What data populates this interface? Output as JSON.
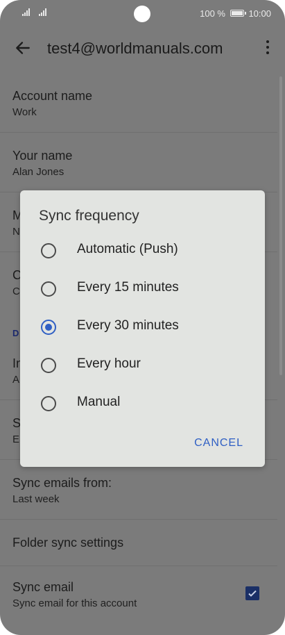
{
  "status": {
    "battery": "100 %",
    "time": "10:00"
  },
  "appbar": {
    "title": "test4@worldmanuals.com"
  },
  "settings": {
    "account_name": {
      "title": "Account name",
      "value": "Work"
    },
    "your_name": {
      "title": "Your name",
      "value": "Alan Jones"
    },
    "row3": {
      "title": "M",
      "value": "N"
    },
    "row4": {
      "title": "C",
      "value": "C"
    },
    "section": "D",
    "row6": {
      "title": "In",
      "value": "A"
    },
    "row7": {
      "title": "S",
      "value": "E"
    },
    "sync_emails_from": {
      "title": "Sync emails from:",
      "value": "Last week"
    },
    "folder_sync": {
      "title": "Folder sync settings"
    },
    "sync_email": {
      "title": "Sync email",
      "value": "Sync email for this account",
      "checked": true
    }
  },
  "dialog": {
    "title": "Sync frequency",
    "options": [
      {
        "label": "Automatic (Push)",
        "selected": false
      },
      {
        "label": "Every 15 minutes",
        "selected": false
      },
      {
        "label": "Every 30 minutes",
        "selected": true
      },
      {
        "label": "Every hour",
        "selected": false
      },
      {
        "label": "Manual",
        "selected": false
      }
    ],
    "cancel": "CANCEL"
  },
  "colors": {
    "accent": "#2f5fc4",
    "scrim": "#7b7b7b",
    "dialog_bg": "#e2e4e1"
  }
}
